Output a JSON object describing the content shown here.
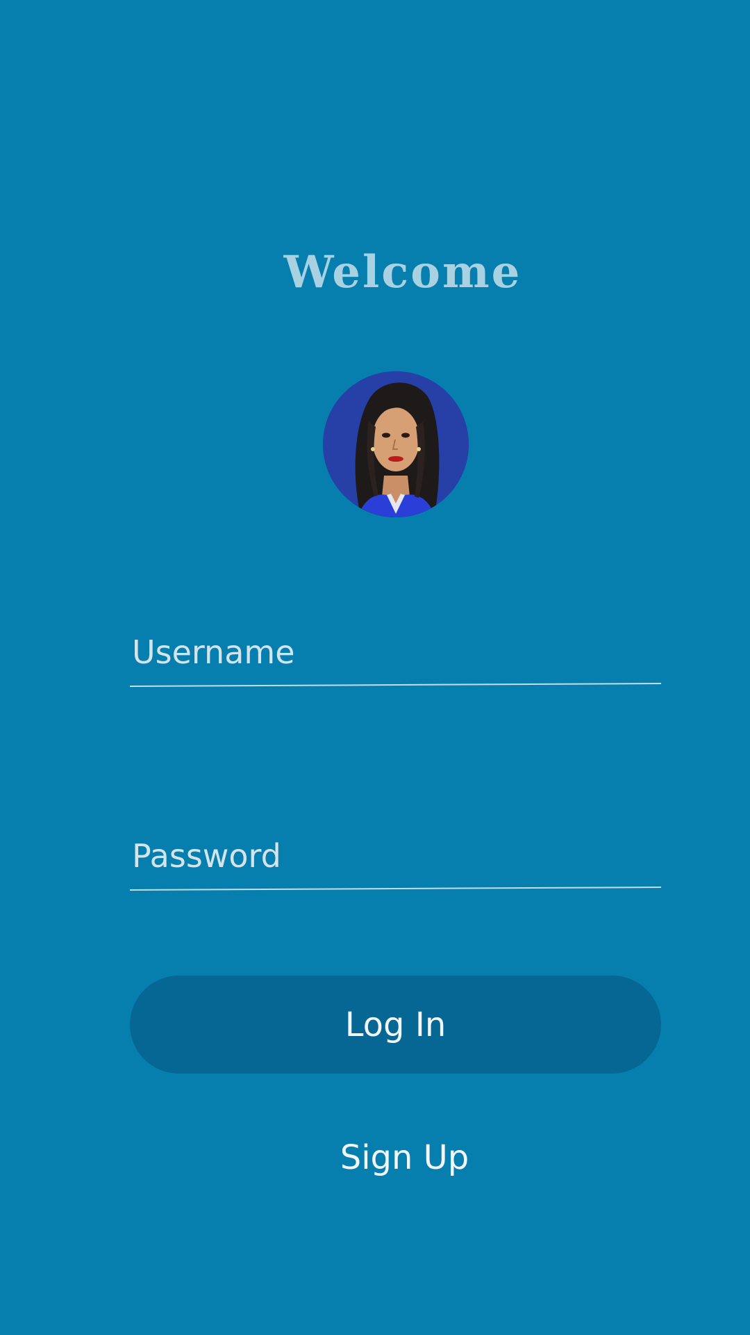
{
  "screen": {
    "title": "Welcome",
    "background_color": "#077fae"
  },
  "avatar": {
    "alt": "profile photo",
    "icon": "profile-photo"
  },
  "form": {
    "username": {
      "placeholder": "Username",
      "value": ""
    },
    "password": {
      "placeholder": "Password",
      "value": ""
    }
  },
  "actions": {
    "login_label": "Log In",
    "signup_label": "Sign Up"
  },
  "colors": {
    "title": "#a8d1e2",
    "button": "#066794",
    "text": "#f2f7fa"
  }
}
